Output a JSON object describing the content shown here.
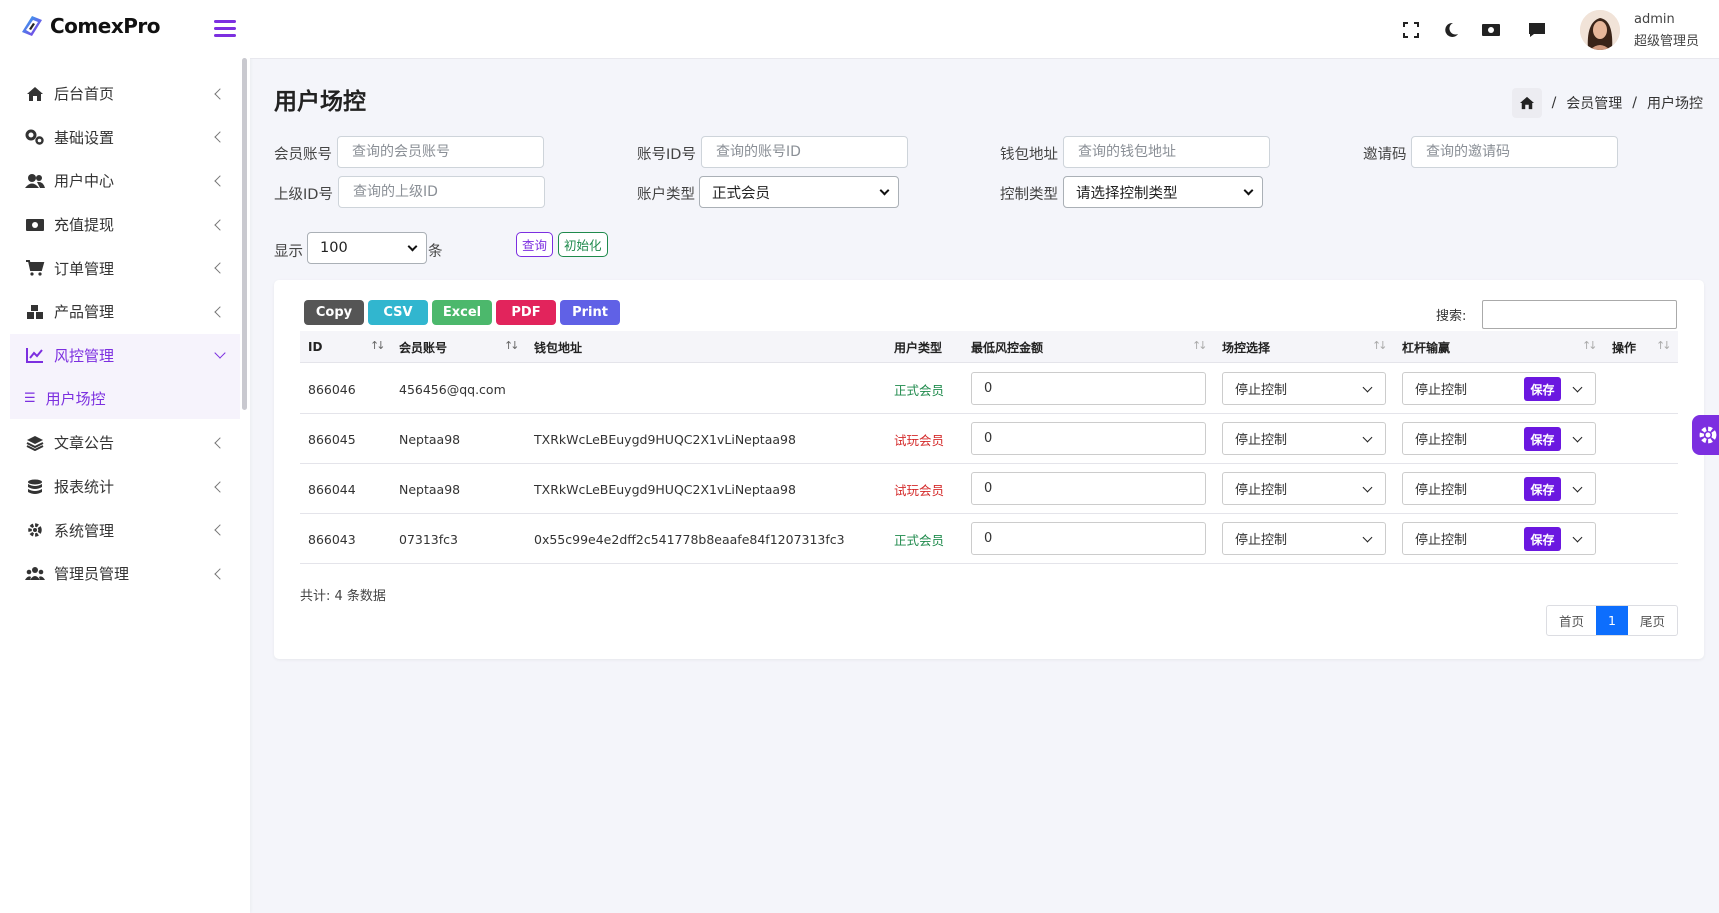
{
  "brand": {
    "name": "ComexPro"
  },
  "sidebar": {
    "items": [
      {
        "label": "后台首页",
        "icon": "home-icon"
      },
      {
        "label": "基础设置",
        "icon": "cogs-icon"
      },
      {
        "label": "用户中心",
        "icon": "users-icon"
      },
      {
        "label": "充值提现",
        "icon": "money-icon"
      },
      {
        "label": "订单管理",
        "icon": "cart-icon"
      },
      {
        "label": "产品管理",
        "icon": "cubes-icon"
      },
      {
        "label": "风控管理",
        "icon": "chart-line-icon",
        "active": true
      },
      {
        "label": "文章公告",
        "icon": "layers-icon"
      },
      {
        "label": "报表统计",
        "icon": "database-icon"
      },
      {
        "label": "系统管理",
        "icon": "gear-icon"
      },
      {
        "label": "管理员管理",
        "icon": "users-group-icon"
      }
    ],
    "submenu": {
      "label": "用户场控",
      "icon": "list-icon"
    }
  },
  "topbar": {
    "icons": [
      "fullscreen-icon",
      "moon-icon",
      "money-icon",
      "comment-icon"
    ],
    "user": {
      "name": "admin",
      "role": "超级管理员"
    }
  },
  "page": {
    "title": "用户场控"
  },
  "breadcrumb": {
    "sep": "/",
    "items": [
      "会员管理",
      "用户场控"
    ]
  },
  "filters": {
    "member_account": {
      "label": "会员账号",
      "placeholder": "查询的会员账号"
    },
    "account_id": {
      "label": "账号ID号",
      "placeholder": "查询的账号ID"
    },
    "wallet": {
      "label": "钱包地址",
      "placeholder": "查询的钱包地址"
    },
    "invite_code": {
      "label": "邀请码",
      "placeholder": "查询的邀请码"
    },
    "parent_id": {
      "label": "上级ID号",
      "placeholder": "查询的上级ID"
    },
    "account_type": {
      "label": "账户类型",
      "value": "正式会员"
    },
    "control_type": {
      "label": "控制类型",
      "value": "请选择控制类型"
    },
    "show": {
      "label": "显示",
      "value": "100",
      "suffix": "条"
    },
    "query_button": "查询",
    "reset_button": "初始化"
  },
  "export": {
    "copy": "Copy",
    "csv": "CSV",
    "excel": "Excel",
    "pdf": "PDF",
    "print": "Print"
  },
  "search": {
    "label": "搜索:",
    "value": ""
  },
  "table": {
    "headers": [
      "ID",
      "会员账号",
      "钱包地址",
      "用户类型",
      "最低风控金额",
      "场控选择",
      "杠杆输赢",
      "操作"
    ],
    "rows": [
      {
        "id": "866046",
        "account": "456456@qq.com",
        "wallet": "",
        "type": "正式会员",
        "type_color": "#1f8a4c",
        "min_amount": "0",
        "control": "停止控制",
        "leverage": "停止控制",
        "action": "保存"
      },
      {
        "id": "866045",
        "account": "Neptaa98",
        "wallet": "TXRkWcLeBEuygd9HUQC2X1vLiNeptaa98",
        "type": "试玩会员",
        "type_color": "#d42a2a",
        "min_amount": "0",
        "control": "停止控制",
        "leverage": "停止控制",
        "action": "保存"
      },
      {
        "id": "866044",
        "account": "Neptaa98",
        "wallet": "TXRkWcLeBEuygd9HUQC2X1vLiNeptaa98",
        "type": "试玩会员",
        "type_color": "#d42a2a",
        "min_amount": "0",
        "control": "停止控制",
        "leverage": "停止控制",
        "action": "保存"
      },
      {
        "id": "866043",
        "account": "07313fc3",
        "wallet": "0x55c99e4e2dff2c541778b8eaafe84f1207313fc3",
        "type": "正式会员",
        "type_color": "#1f8a4c",
        "min_amount": "0",
        "control": "停止控制",
        "leverage": "停止控制",
        "action": "保存"
      }
    ]
  },
  "total": "共计: 4 条数据",
  "pagination": {
    "first": "首页",
    "current": "1",
    "last": "尾页"
  },
  "colors": {
    "accent": "#7c2fe0",
    "save": "#6b17e0",
    "page_current": "#0d6efd"
  }
}
